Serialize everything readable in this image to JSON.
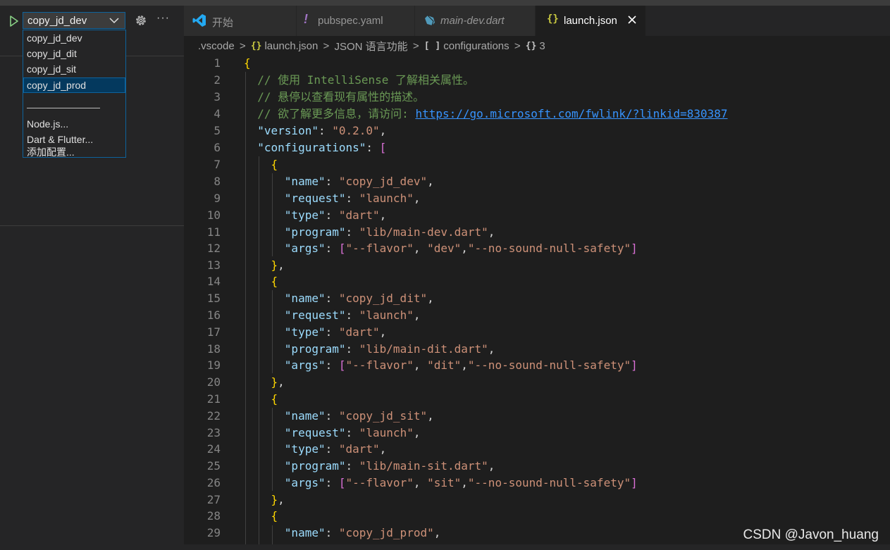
{
  "sidebar": {
    "selected_config": "copy_jd_dev",
    "dropdown_items": [
      "copy_jd_dev",
      "copy_jd_dit",
      "copy_jd_sit",
      "copy_jd_prod",
      "Node.js...",
      "Dart & Flutter...",
      "添加配置..."
    ],
    "selected_index": 3
  },
  "tabs": [
    {
      "label": "开始",
      "icon": "vscode-icon",
      "active": false
    },
    {
      "label": "pubspec.yaml",
      "icon": "yaml-exclamation-icon",
      "active": false
    },
    {
      "label": "main-dev.dart",
      "icon": "dart-icon",
      "active": false,
      "italic": true
    },
    {
      "label": "launch.json",
      "icon": "json-braces-icon",
      "active": true
    }
  ],
  "breadcrumb": {
    "folder": ".vscode",
    "file": "launch.json",
    "section": "JSON 语言功能",
    "array": "configurations",
    "index": "3"
  },
  "code": {
    "line_numbers": [
      "1",
      "2",
      "3",
      "4",
      "5",
      "6",
      "7",
      "8",
      "9",
      "10",
      "11",
      "12",
      "13",
      "14",
      "15",
      "16",
      "17",
      "18",
      "19",
      "20",
      "21",
      "22",
      "23",
      "24",
      "25",
      "26",
      "27",
      "28",
      "29"
    ],
    "comment_1": "// 使用 IntelliSense 了解相关属性。",
    "comment_2": "// 悬停以查看现有属性的描述。",
    "comment_3_prefix": "// 欲了解更多信息，请访问: ",
    "comment_3_url": "https://go.microsoft.com/fwlink/?linkid=830387",
    "version_key": "\"version\"",
    "version_value": "\"0.2.0\"",
    "configurations_key": "\"configurations\"",
    "keys": {
      "name": "\"name\"",
      "request": "\"request\"",
      "type": "\"type\"",
      "program": "\"program\"",
      "args": "\"args\""
    },
    "values": {
      "launch": "\"launch\"",
      "dart": "\"dart\"",
      "flavor": "\"--flavor\"",
      "null_safety": "\"--no-sound-null-safety\""
    },
    "configs": [
      {
        "name": "\"copy_jd_dev\"",
        "program": "\"lib/main-dev.dart\"",
        "flavor": "\"dev\""
      },
      {
        "name": "\"copy_jd_dit\"",
        "program": "\"lib/main-dit.dart\"",
        "flavor": "\"dit\""
      },
      {
        "name": "\"copy_jd_sit\"",
        "program": "\"lib/main-sit.dart\"",
        "flavor": "\"sit\""
      },
      {
        "name": "\"copy_jd_prod\""
      }
    ]
  },
  "watermark": "CSDN @Javon_huang",
  "colors": {
    "accent": "#0e639c",
    "selection": "#04395e",
    "json_icon": "#cbcb41",
    "yaml_icon": "#a074c4",
    "dart_icon": "#519aba",
    "vscode_icon": "#23a9f2"
  }
}
